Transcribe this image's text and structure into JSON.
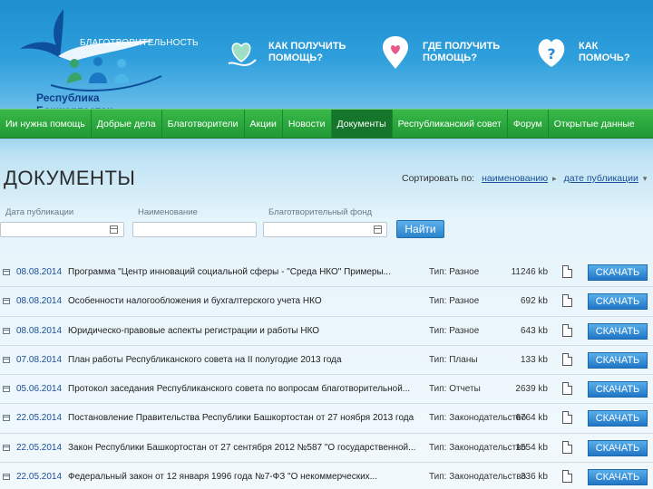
{
  "header": {
    "logo_tagline": "БЛАГОТВОРИТЕЛЬНОСТЬ",
    "logo_region": "Республика Башкортостан",
    "nav": [
      {
        "line1": "КАК ПОЛУЧИТЬ",
        "line2": "ПОМОЩЬ?",
        "icon": "heart-hand-icon"
      },
      {
        "line1": "ГДЕ ПОЛУЧИТЬ",
        "line2": "ПОМОЩЬ?",
        "icon": "map-pin-heart-icon"
      },
      {
        "line1": "КАК",
        "line2": "ПОМОЧЬ?",
        "icon": "question-heart-icon"
      }
    ]
  },
  "menu": {
    "items": [
      {
        "label": "Ии нужна помощь"
      },
      {
        "label": "Добрые дела"
      },
      {
        "label": "Благотворители"
      },
      {
        "label": "Акции"
      },
      {
        "label": "Новости"
      },
      {
        "label": "Документы"
      },
      {
        "label": "Республиканский совет"
      },
      {
        "label": "Форум"
      },
      {
        "label": "Открытые данные"
      }
    ],
    "active": "Документы"
  },
  "page": {
    "title": "ДОКУМЕНТЫ",
    "sort_label": "Сортировать по:",
    "sort_by_name": "наименованию",
    "sort_by_date": "дате публикации"
  },
  "filters": {
    "date_label": "Дата публикации",
    "name_label": "Наименование",
    "fund_label": "Благотворительный фонд",
    "date_value": "",
    "name_value": "",
    "fund_value": "",
    "find_button": "Найти"
  },
  "documents": {
    "type_prefix": "Тип:",
    "download_label": "СКАЧАТЬ",
    "rows": [
      {
        "date": "08.08.2014",
        "title": "Программа \"Центр инноваций социальной сферы - \"Среда НКО\" Примеры...",
        "type": "Разное",
        "size": "11246 kb"
      },
      {
        "date": "08.08.2014",
        "title": "Особенности налогообложения и бухгалтерского учета НКО",
        "type": "Разное",
        "size": "692 kb"
      },
      {
        "date": "08.08.2014",
        "title": "Юридическо-правовые аспекты регистрации и работы НКО",
        "type": "Разное",
        "size": "643 kb"
      },
      {
        "date": "07.08.2014",
        "title": "План работы Республиканского совета на II полугодие 2013 года",
        "type": "Планы",
        "size": "133 kb"
      },
      {
        "date": "05.06.2014",
        "title": "Протокол заседания Республиканского совета по вопросам благотворительной...",
        "type": "Отчеты",
        "size": "2639 kb"
      },
      {
        "date": "22.05.2014",
        "title": "Постановление Правительства Республики Башкортостан от 27 ноября 2013 года",
        "type": "Законодательство",
        "size": "6764 kb"
      },
      {
        "date": "22.05.2014",
        "title": "Закон Республики Башкортостан от 27 сентября 2012 №587 \"О государственной...",
        "type": "Законодательство",
        "size": "1554 kb"
      },
      {
        "date": "22.05.2014",
        "title": "Федеральный закон от 12 января 1996 года №7-ФЗ \"О некоммерческих...",
        "type": "Законодательство",
        "size": "336 kb"
      }
    ]
  }
}
